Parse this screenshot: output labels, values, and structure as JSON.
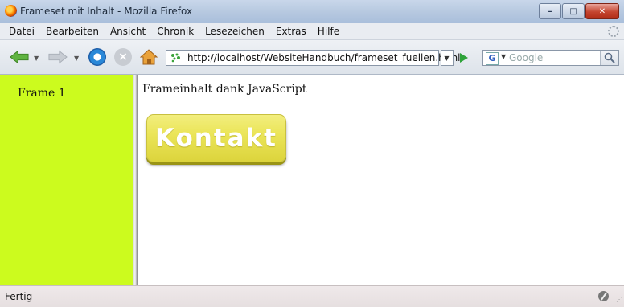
{
  "window": {
    "title": "Frameset mit Inhalt - Mozilla Firefox",
    "controls": {
      "minimize": "–",
      "maximize": "□",
      "close": "✕"
    }
  },
  "menu": {
    "items": [
      "Datei",
      "Bearbeiten",
      "Ansicht",
      "Chronik",
      "Lesezeichen",
      "Extras",
      "Hilfe"
    ]
  },
  "toolbar": {
    "url": "http://localhost/WebsiteHandbuch/frameset_fuellen.html",
    "search_placeholder": "Google",
    "url_dropdown": "▼",
    "engine_dropdown": "▼"
  },
  "frames": {
    "left": {
      "label": "Frame 1",
      "background": "#ccfb1e"
    },
    "right": {
      "text": "Frameinhalt dank JavaScript",
      "button_label": "Kontakt",
      "button_color": "#ebe559"
    }
  },
  "status": {
    "text": "Fertig"
  },
  "icons": [
    "firefox-logo-icon",
    "back-arrow-icon",
    "forward-arrow-icon",
    "reload-icon",
    "stop-icon",
    "home-icon",
    "site-favicon-icon",
    "go-arrow-icon",
    "google-engine-icon",
    "search-magnifier-icon",
    "throbber-icon",
    "noscript-icon"
  ]
}
